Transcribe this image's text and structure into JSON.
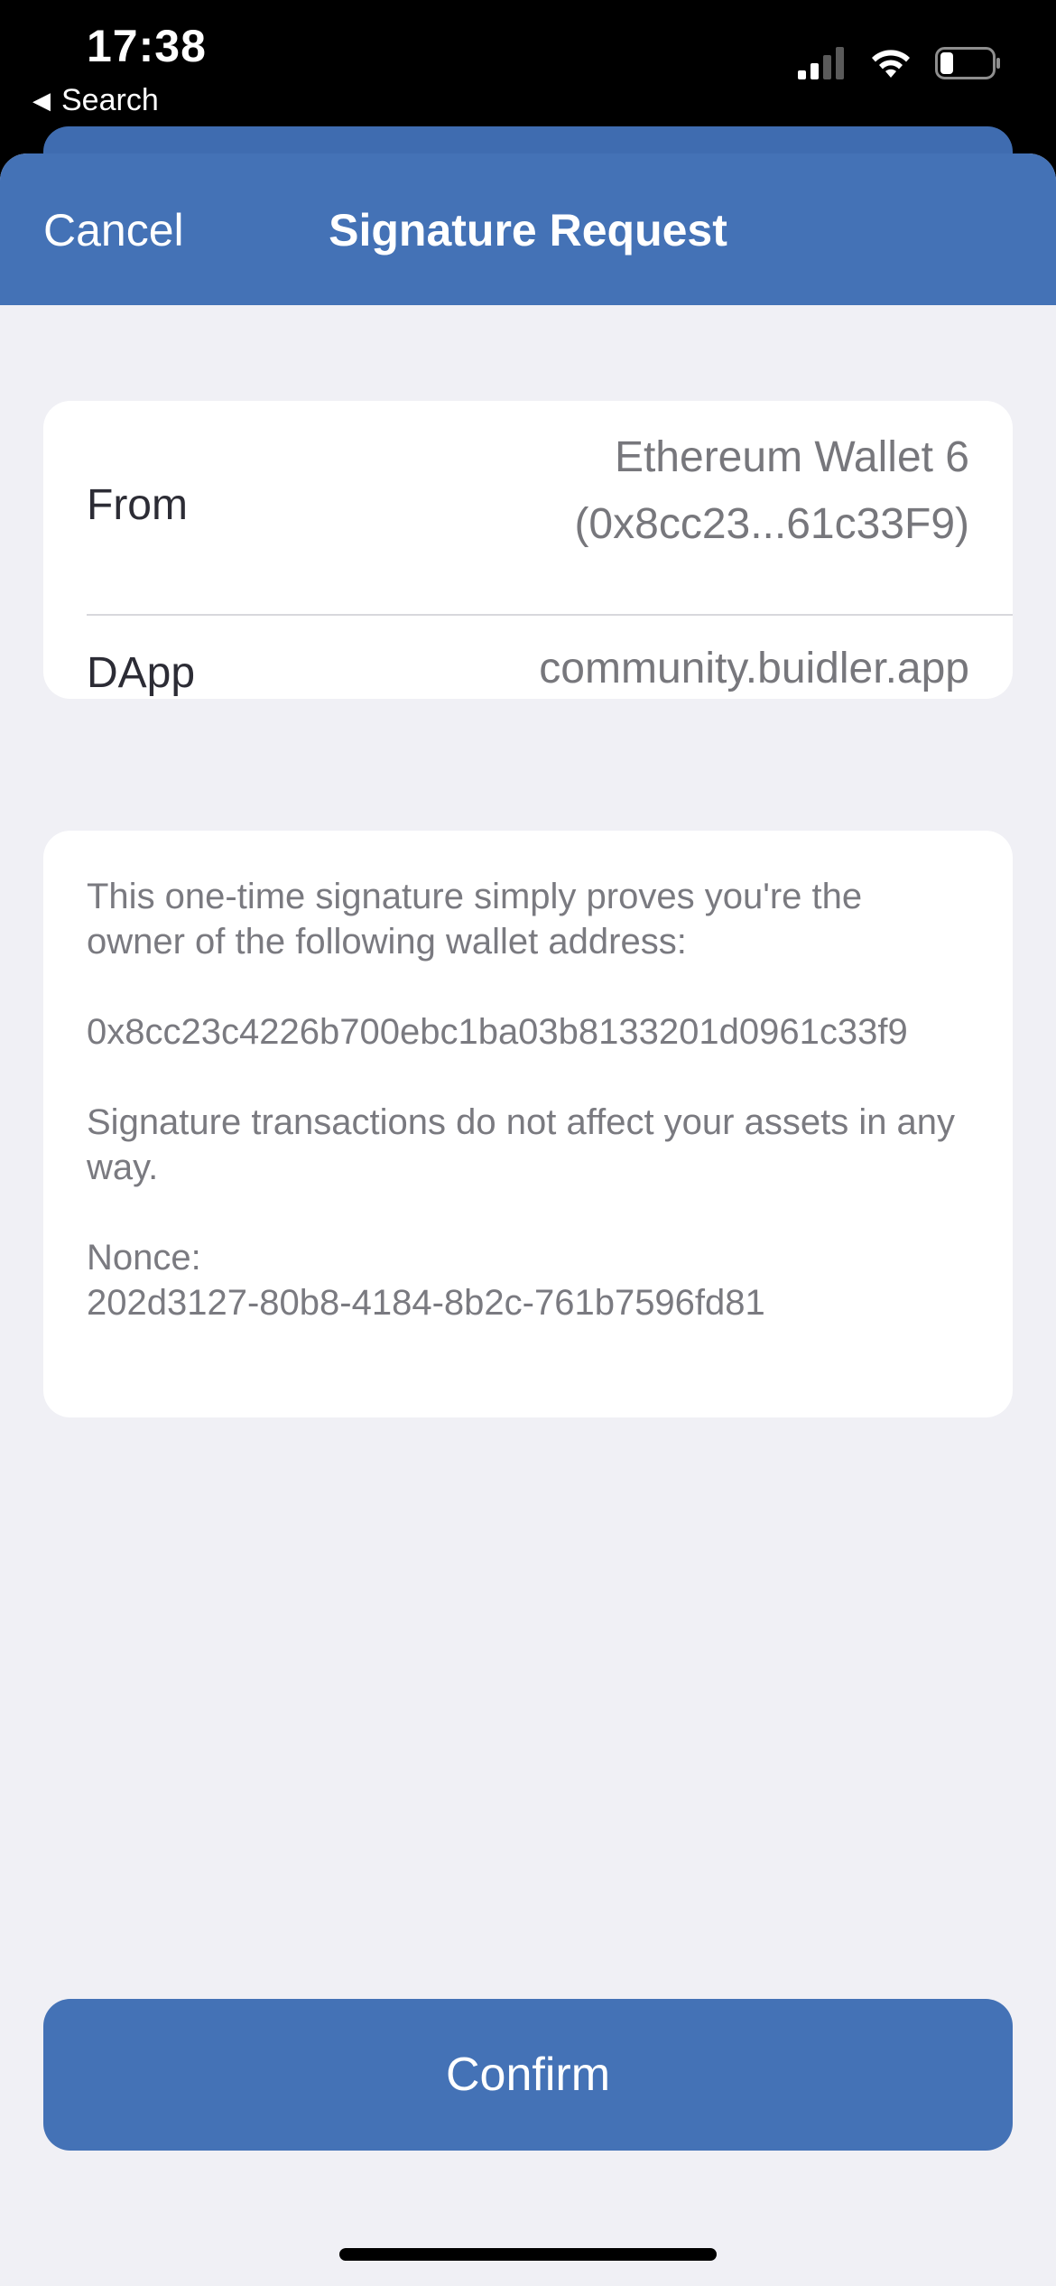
{
  "status_bar": {
    "time": "17:38",
    "back_label": "Search",
    "back_icon": "back-triangle-icon",
    "signal_icon": "cellular-signal-icon",
    "wifi_icon": "wifi-icon",
    "battery_icon": "battery-icon"
  },
  "nav": {
    "cancel_label": "Cancel",
    "title": "Signature Request"
  },
  "info": {
    "from_label": "From",
    "from_wallet": "Ethereum Wallet 6",
    "from_address": "(0x8cc23...61c33F9)",
    "dapp_label": "DApp",
    "dapp_value": "community.buidler.app"
  },
  "message": {
    "intro": "This one-time signature simply proves you're the owner of the following wallet address:",
    "address": "0x8cc23c4226b700ebc1ba03b8133201d0961c33f9",
    "notice": "Signature transactions do not affect your assets in any way.",
    "nonce_label": "Nonce:",
    "nonce_value": "202d3127-80b8-4184-8b2c-761b7596fd81"
  },
  "confirm_label": "Confirm",
  "colors": {
    "accent": "#4472b6",
    "background": "#f0f0f5",
    "card": "#ffffff",
    "secondary_text": "#77777c"
  }
}
